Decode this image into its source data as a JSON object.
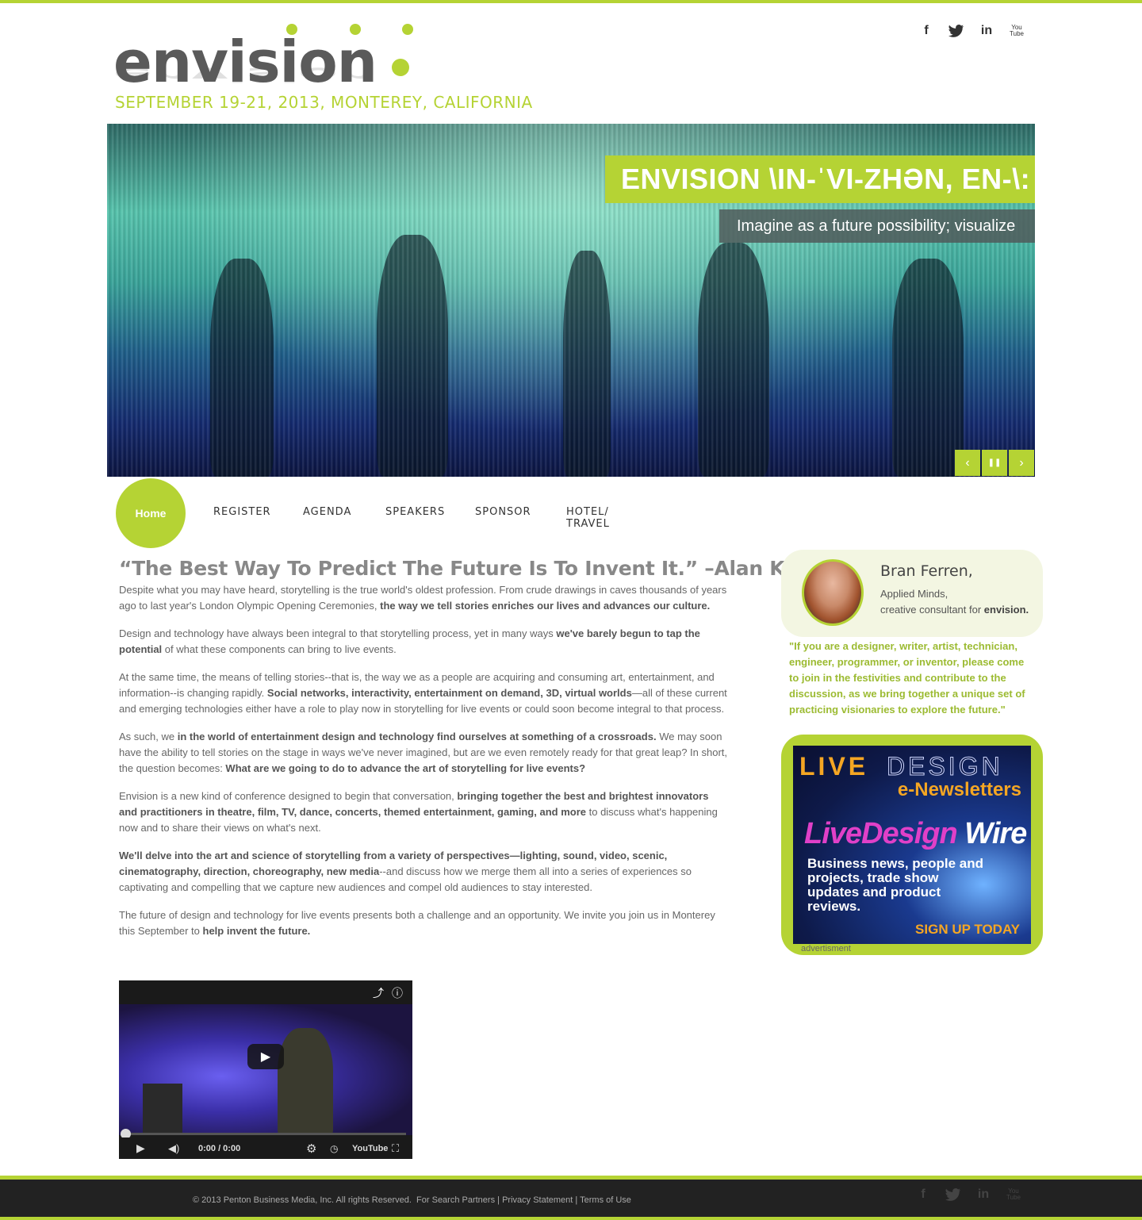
{
  "brand": {
    "logo_text": "envision",
    "event_date": "SEPTEMBER 19-21, 2013, MONTEREY, CALIFORNIA",
    "accent_color": "#b5d334"
  },
  "social": [
    {
      "name": "facebook-icon",
      "glyph": "f"
    },
    {
      "name": "twitter-icon",
      "glyph": "t"
    },
    {
      "name": "linkedin-icon",
      "glyph": "in"
    },
    {
      "name": "youtube-icon",
      "glyph": "You Tube"
    }
  ],
  "hero": {
    "title": "ENVISION \\IN-ˈVI-ZHƏN, EN-\\:",
    "subtitle": "Imagine as a future possibility; visualize",
    "controls": {
      "prev": "‹",
      "pause": "❚❚",
      "next": "›"
    }
  },
  "nav": {
    "home": "Home",
    "register": "REGISTER",
    "agenda": "AGENDA",
    "speakers": "SPEAKERS",
    "sponsor": "SPONSOR",
    "hotel_line1": "HOTEL/",
    "hotel_line2": "TRAVEL"
  },
  "main": {
    "quote": "“The Best Way To Predict The Future Is To Invent It.” –Alan Kay",
    "p1a": "Despite what you may have heard, storytelling is the true world's oldest profession. From crude drawings in caves thousands of years ago to last year's London Olympic Opening Ceremonies, ",
    "p1b": "the way we tell stories enriches our lives and advances our culture.",
    "p2a": "Design and technology have always been integral to that storytelling process, yet in many ways ",
    "p2b": "we've barely begun to tap the potential",
    "p2c": " of what these components can bring to live events.",
    "p3a": "At the same time, the means of telling stories--that is, the way we as a people are acquiring and consuming art, entertainment, and information--is changing rapidly. ",
    "p3b": "Social networks, interactivity, entertainment on demand, 3D, virtual worlds",
    "p3c": "—all of these current and emerging technologies either have a role to play now in storytelling for live events or could soon become integral to that process.",
    "p4a": "As such, we ",
    "p4b": "in the world of entertainment design and technology find ourselves at something of a crossroads.",
    "p4c": " We may soon have the ability to tell stories on the stage in ways we've never imagined, but are we even remotely ready for that great leap? In short, the question becomes: ",
    "p4d": "What are we going to do to advance the art of storytelling for live events?",
    "p5a": "Envision is a new kind of conference designed to begin that conversation, ",
    "p5b": "bringing together the best and brightest innovators and practitioners in theatre, film, TV, dance, concerts, themed entertainment, gaming, and more",
    "p5c": " to discuss what's happening now and to share their views on what's next.",
    "p6a": "We'll delve into the art and science of storytelling from a variety of perspectives—lighting, sound, video, scenic, cinematography, direction, choreography, new media",
    "p6b": "--and discuss how we merge them all into a series of experiences so captivating and compelling that we capture new audiences and compel old audiences to stay interested.",
    "p7a": "The future of design and technology for live events presents both a challenge and an opportunity. We invite you join us in Monterey this September to ",
    "p7b": "help invent the future."
  },
  "video": {
    "time": "0:00 / 0:00",
    "progress": 0
  },
  "speaker": {
    "name": "Bran Ferren,",
    "org": "Applied Minds,",
    "role_prefix": "creative consultant for ",
    "role_brand": "envision.",
    "quote": "\"If you are a designer, writer, artist, technician, engineer, programmer, or inventor, please come to join in the festivities and contribute to the discussion, as we bring together a unique set of practicing visionaries to explore the future.\""
  },
  "ad": {
    "live": "LIVE",
    "design": "DESIGN",
    "enews": "e-Newsletters",
    "wire_a": "LiveDesign",
    "wire_b": "Wire",
    "copy": "Business news, people and projects, trade show updates and product reviews.",
    "cta": "SIGN UP TODAY",
    "label": "advertisment"
  },
  "footer": {
    "copyright": "© 2013 Penton Business Media, Inc. All rights Reserved.",
    "link1": "For Search Partners",
    "link2": "Privacy Statement",
    "link3": "Terms of Use",
    "sep": "|"
  }
}
